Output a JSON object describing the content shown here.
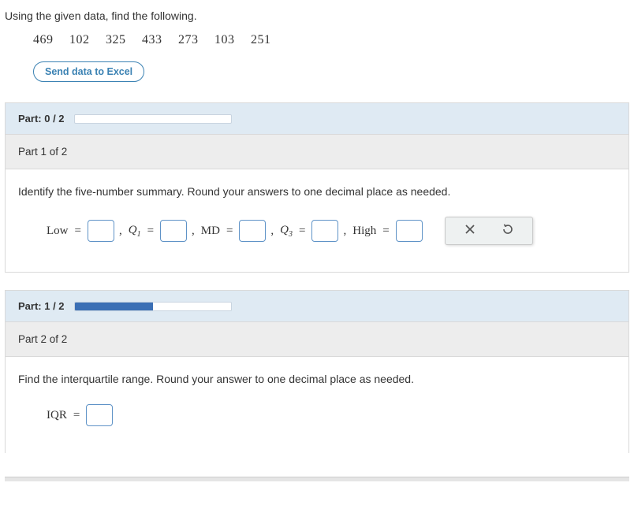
{
  "intro": "Using the given data, find the following.",
  "data_values": [
    "469",
    "102",
    "325",
    "433",
    "273",
    "103",
    "251"
  ],
  "send_button": "Send data to Excel",
  "part1": {
    "progress_label": "Part: 0 / 2",
    "progress_pct": 0,
    "sub_header": "Part 1 of 2",
    "prompt": "Identify the five-number summary. Round your answers to one decimal place as needed.",
    "labels": {
      "low": "Low",
      "q1": "Q",
      "q1_sub": "1",
      "md": "MD",
      "q3": "Q",
      "q3_sub": "3",
      "high": "High"
    }
  },
  "part2": {
    "progress_label": "Part: 1 / 2",
    "progress_pct": 50,
    "sub_header": "Part 2 of 2",
    "prompt": "Find the interquartile range. Round your answer to one decimal place as needed.",
    "iqr_label": "IQR"
  }
}
